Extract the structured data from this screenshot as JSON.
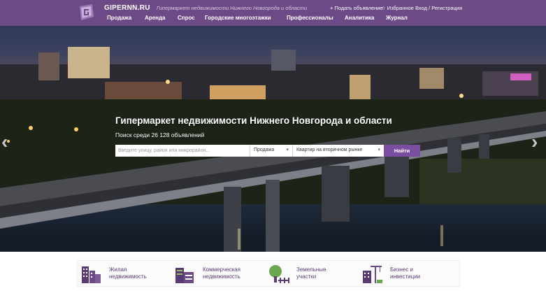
{
  "header": {
    "logo_text": "GIPERNN.RU",
    "tagline": "Гипермаркет недвижимости Нижнего Новгорода и области",
    "add_listing": "+ Подать объявление",
    "favorites": "☆ Избранное",
    "login": "Вход / Регистрация",
    "nav": [
      "Продажа",
      "Аренда",
      "Спрос",
      "Городские многоэтажки",
      "Профессионалы",
      "Аналитика",
      "Журнал"
    ]
  },
  "hero": {
    "title": "Гипермаркет недвижимости Нижнего Новгорода и области",
    "subtitle": "Поиск среди 26 128 объявлений",
    "search_placeholder": "Введите улицу, район или микрорайон...",
    "deal_type": "Продажа",
    "property_type": "Квартир на вторичном рынке",
    "search_button": "Найти",
    "prev_arrow": "‹",
    "next_arrow": "›"
  },
  "categories": [
    {
      "line1": "Жилая",
      "line2": "недвижимость",
      "icon": "residential-building-icon"
    },
    {
      "line1": "Коммерческая",
      "line2": "недвижимость",
      "icon": "commercial-building-icon"
    },
    {
      "line1": "Земельные",
      "line2": "участки",
      "icon": "tree-land-icon"
    },
    {
      "line1": "Бизнес и",
      "line2": "инвестиции",
      "icon": "business-crane-icon"
    }
  ],
  "colors": {
    "brand": "#6b4a86",
    "button": "#7b4d9e"
  }
}
